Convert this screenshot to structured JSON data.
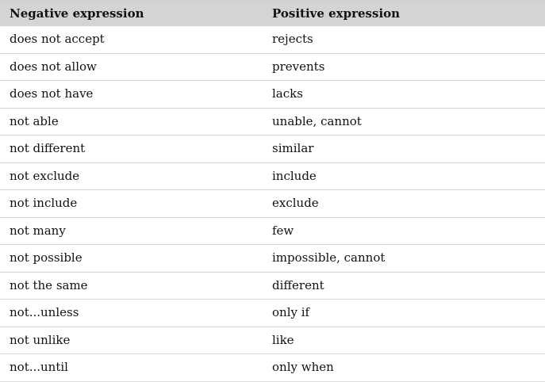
{
  "table": {
    "headers": [
      "Negative expression",
      "Positive expression"
    ],
    "rows": [
      [
        "does not accept",
        "rejects"
      ],
      [
        "does not allow",
        "prevents"
      ],
      [
        "does not have",
        "lacks"
      ],
      [
        "not able",
        "unable, cannot"
      ],
      [
        "not different",
        "similar"
      ],
      [
        "not exclude",
        "include"
      ],
      [
        "not include",
        "exclude"
      ],
      [
        "not many",
        "few"
      ],
      [
        "not possible",
        "impossible, cannot"
      ],
      [
        "not the same",
        "different"
      ],
      [
        "not...unless",
        "only if"
      ],
      [
        "not unlike",
        "like"
      ],
      [
        "not...until",
        "only when"
      ]
    ]
  },
  "colors": {
    "header_bg": "#d4d4d4",
    "divider": "#d6d6d6",
    "text": "#111111"
  }
}
